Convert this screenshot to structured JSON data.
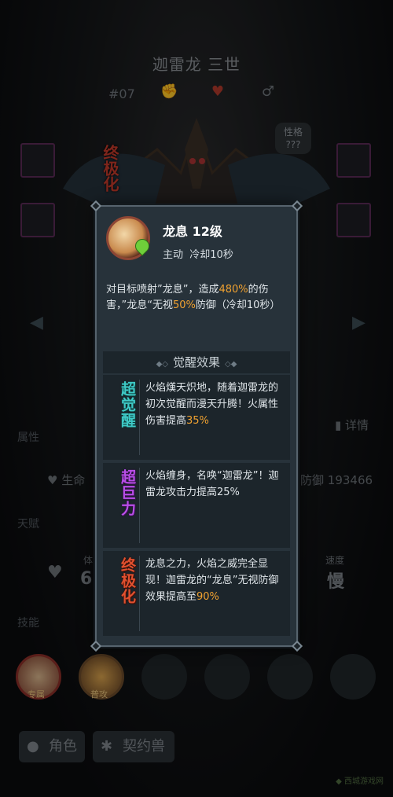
{
  "hero": {
    "name": "迦雷龙 三世",
    "number": "#07",
    "final_badge": "终极化",
    "trait_bubble": "性格\n???"
  },
  "stats": {
    "section_attr": "属性",
    "details": "详情",
    "hp_label": "生命",
    "def_label": "防御",
    "def_value": "193466",
    "section_talent": "天赋",
    "stamina_label": "体",
    "stamina_value": "6.",
    "speed_label": "速度",
    "speed_value": "慢",
    "section_skill": "技能",
    "skill1_tag": "专属",
    "skill2_tag": "普攻"
  },
  "tabs": {
    "character": "角色",
    "contract_beast": "契约兽"
  },
  "popup": {
    "skill_name": "龙息 12级",
    "skill_type": "主动",
    "cooldown": "冷却10秒",
    "desc_part1": "对目标喷射”龙息”，造成",
    "desc_hl1": "480%",
    "desc_part2": "的伤害，”龙息“无视",
    "desc_hl2": "50%",
    "desc_part3": "防御（冷却10秒）",
    "awaken_header": "觉醒效果",
    "awakenings": [
      {
        "badge": "超觉醒",
        "text_a": "火焰熯天炽地，随着迦雷龙的初次觉醒而漫天升腾！火属性伤害提高",
        "hl": "35%",
        "text_b": ""
      },
      {
        "badge": "超巨力",
        "text_a": "火焰缠身，名唤“迦雷龙”！迦雷龙攻击力提高25%",
        "hl": "",
        "text_b": ""
      },
      {
        "badge": "终极化",
        "text_a": "龙息之力，火焰之威完全显现！迦雷龙的“龙息”无视防御效果提高至",
        "hl": "90%",
        "text_b": ""
      }
    ]
  },
  "colors": {
    "highlight": "#f1a230",
    "awaken_cyan": "#3ec9c6",
    "awaken_purple": "#a63cd6",
    "awaken_red": "#d8462e"
  }
}
